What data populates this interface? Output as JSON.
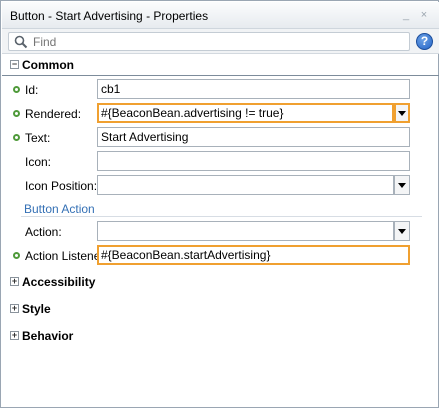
{
  "window": {
    "title": "Button - Start Advertising - Properties",
    "minimize_glyph": "_",
    "close_glyph": "×"
  },
  "find": {
    "placeholder": "Find",
    "icon": "search-icon"
  },
  "help": {
    "glyph": "?",
    "icon": "help-icon"
  },
  "sections": {
    "common": {
      "label": "Common",
      "toggle": "−",
      "expanded": true
    },
    "accessibility": {
      "label": "Accessibility",
      "toggle": "+",
      "expanded": false
    },
    "style": {
      "label": "Style",
      "toggle": "+",
      "expanded": false
    },
    "behavior": {
      "label": "Behavior",
      "toggle": "+",
      "expanded": false
    }
  },
  "properties": {
    "id": {
      "label": "Id:",
      "value": "cb1"
    },
    "rendered": {
      "label": "Rendered:",
      "value": "#{BeaconBean.advertising != true}"
    },
    "text": {
      "label": "Text:",
      "value": "Start Advertising"
    },
    "icon": {
      "label": "Icon:",
      "value": ""
    },
    "icon_position": {
      "label": "Icon Position:",
      "value": ""
    },
    "button_action_group": "Button Action",
    "action": {
      "label": "Action:",
      "value": ""
    },
    "action_listener": {
      "label": "Action Listener:",
      "value": "#{BeaconBean.startAdvertising}"
    }
  },
  "colors": {
    "highlight_border": "#f0a030",
    "set_indicator": "#4f9a3a",
    "group_label": "#3470b5"
  }
}
